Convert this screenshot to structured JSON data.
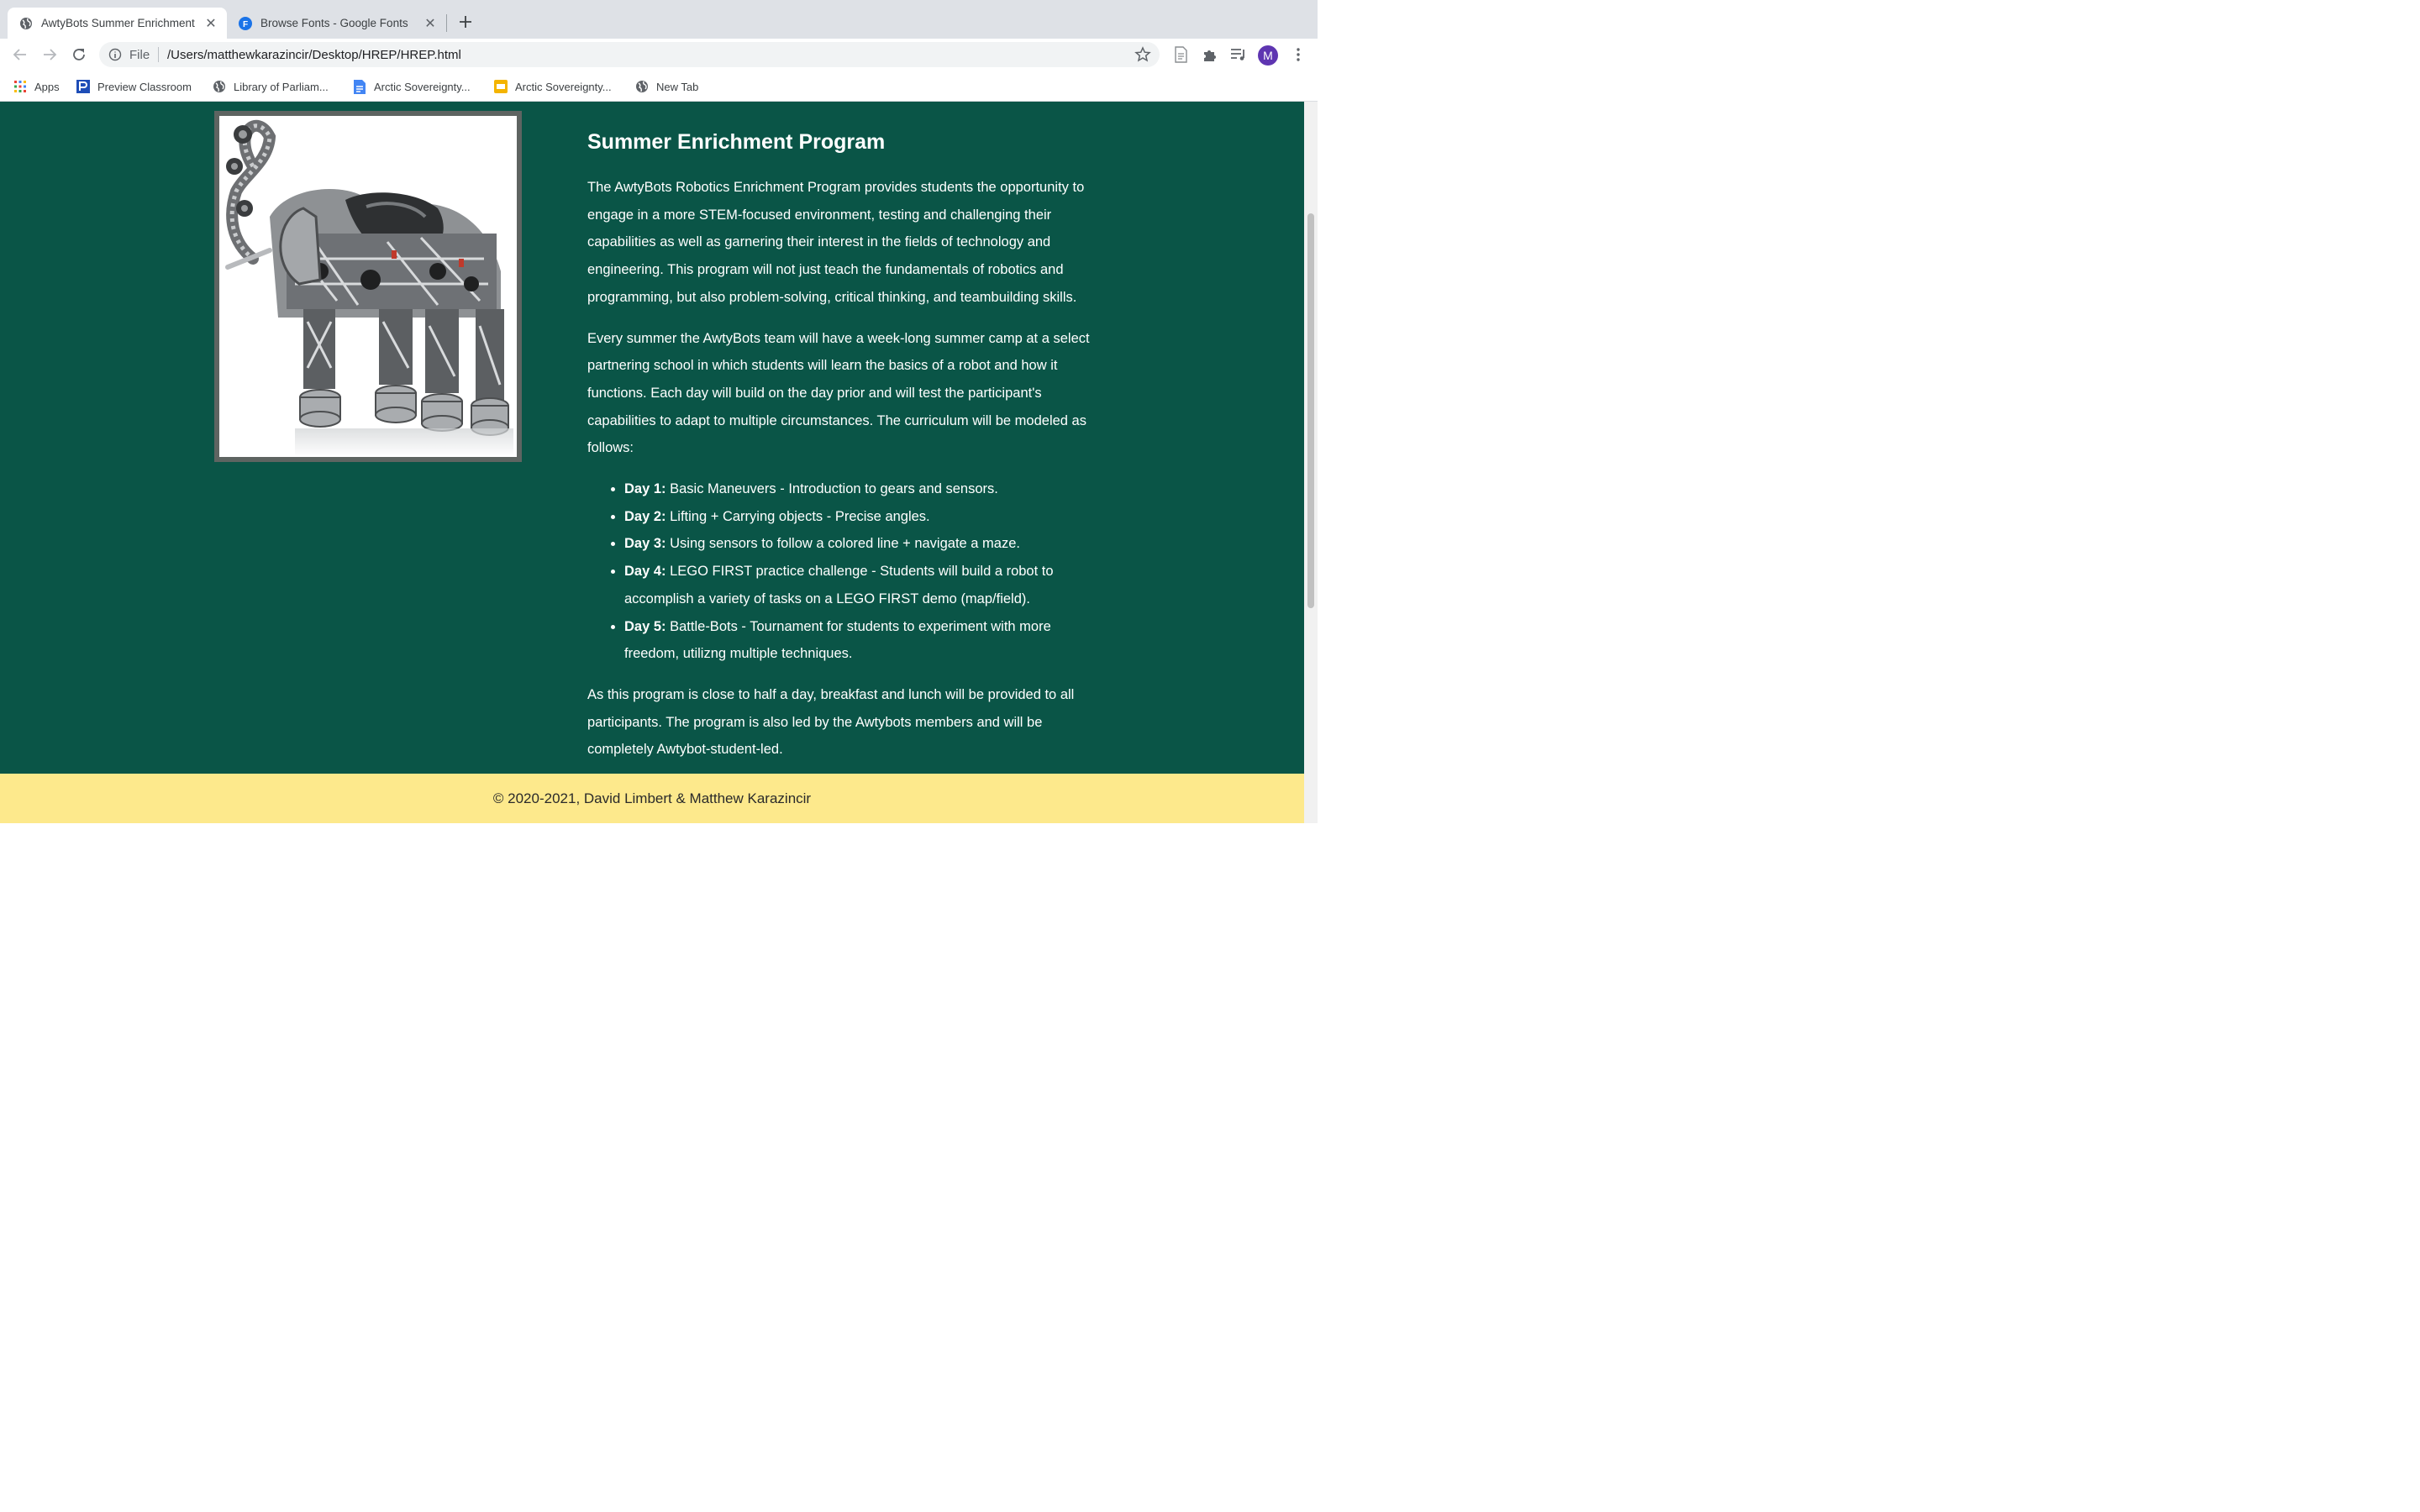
{
  "browser": {
    "tabs": [
      {
        "title": "AwtyBots Summer Enrichment",
        "favicon": "globe-icon",
        "active": true
      },
      {
        "title": "Browse Fonts - Google Fonts",
        "favicon": "google-fonts-icon",
        "favicon_letter": "F",
        "active": false
      }
    ],
    "url_scheme": "File",
    "url": "/Users/matthewkarazincir/Desktop/HREP/HREP.html",
    "avatar_letter": "M",
    "bookmarks": [
      {
        "label": "Apps",
        "icon": "apps-grid-icon"
      },
      {
        "label": "Preview Classroom",
        "icon": "p-logo-icon"
      },
      {
        "label": "Library of Parliam...",
        "icon": "globe-icon"
      },
      {
        "label": "Arctic Sovereignty...",
        "icon": "google-docs-icon"
      },
      {
        "label": "Arctic Sovereignty...",
        "icon": "google-slides-icon"
      },
      {
        "label": "New Tab",
        "icon": "globe-icon"
      }
    ]
  },
  "page": {
    "image": {
      "description_icon": "lego-robot-elephant-image"
    },
    "heading": "Summer Enrichment Program",
    "paragraphs": [
      "The AwtyBots Robotics Enrichment Program provides students the opportunity to engage in a more STEM-focused environment, testing and challenging their capabilities as well as garnering their interest in the fields of technology and engineering. This program will not just teach the fundamentals of robotics and programming, but also problem-solving, critical thinking, and teambuilding skills.",
      "Every summer the AwtyBots team will have a week-long summer camp at a select partnering school in which students will learn the basics of a robot and how it functions. Each day will build on the day prior and will test the participant's capabilities to adapt to multiple circumstances. The curriculum will be modeled as follows:"
    ],
    "curriculum": [
      {
        "day": "Day 1:",
        "text": "Basic Maneuvers - Introduction to gears and sensors."
      },
      {
        "day": "Day 2:",
        "text": "Lifting + Carrying objects - Precise angles."
      },
      {
        "day": "Day 3:",
        "text": "Using sensors to follow a colored line + navigate a maze."
      },
      {
        "day": "Day 4:",
        "text": "LEGO FIRST practice challenge - Students will build a robot to accomplish a variety of tasks on a LEGO FIRST demo (map/field)."
      },
      {
        "day": "Day 5:",
        "text": "Battle-Bots - Tournament for students to experiment with more freedom, utilizng multiple techniques."
      }
    ],
    "closing": "As this program is close to half a day, breakfast and lunch will be provided to all participants. The program is also led by the Awtybots members and will be completely Awtybot-student-led.",
    "footer": "© 2020-2021, David Limbert & Matthew Karazincir"
  },
  "colors": {
    "page_background": "#0a5547",
    "footer_background": "#fde98c",
    "text": "#ffffff"
  }
}
